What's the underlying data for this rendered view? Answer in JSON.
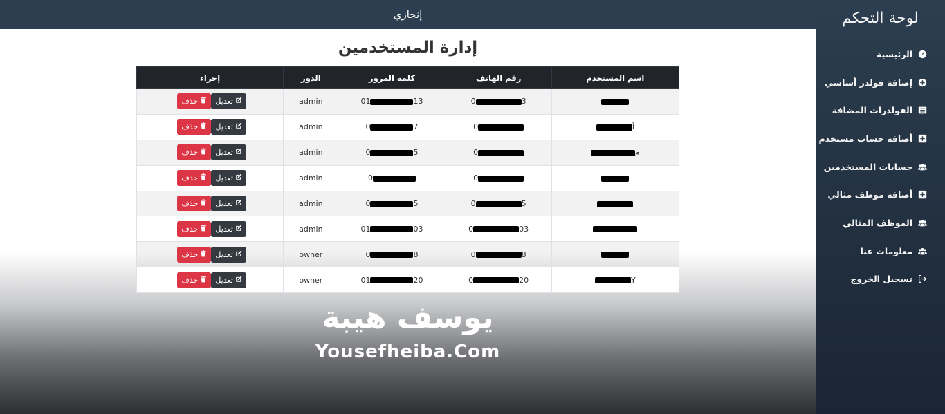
{
  "topbar": {
    "title": "إنجازي"
  },
  "sidebar": {
    "title": "لوحة التحكم",
    "items": [
      {
        "label": "الرئيسية",
        "icon": "dashboard-icon"
      },
      {
        "label": "إضافة فولدر أساسي",
        "icon": "plus-circle-icon"
      },
      {
        "label": "الفولدرات المضافة",
        "icon": "list-icon"
      },
      {
        "label": "أضافه حساب مستخدم",
        "icon": "plus-square-icon"
      },
      {
        "label": "حسابات المستخدمين",
        "icon": "users-icon"
      },
      {
        "label": "أضافه موظف مثالي",
        "icon": "plus-square-icon"
      },
      {
        "label": "الموظف المثالي",
        "icon": "users-icon"
      },
      {
        "label": "معلومات عنا",
        "icon": "users-icon"
      },
      {
        "label": "تسجيل الخروج",
        "icon": "sign-out-icon"
      }
    ]
  },
  "main": {
    "title": "إدارة المستخدمين",
    "table": {
      "headers": [
        "اسم المستخدم",
        "رقم الهاتف",
        "كلمة المرور",
        "الدور",
        "إجراء"
      ],
      "edit_label": "تعديل",
      "delete_label": "حذف",
      "rows": [
        {
          "name": "",
          "phone_prefix": "0",
          "phone_suffix": "3",
          "pass_prefix": "01",
          "pass_suffix": "13",
          "role": "admin"
        },
        {
          "name": "أ",
          "phone_prefix": "0",
          "phone_suffix": "",
          "pass_prefix": "0",
          "pass_suffix": "7",
          "role": "admin"
        },
        {
          "name": "م",
          "phone_prefix": "0",
          "phone_suffix": "",
          "pass_prefix": "0",
          "pass_suffix": "5",
          "role": "admin"
        },
        {
          "name": "",
          "phone_prefix": "0",
          "phone_suffix": "",
          "pass_prefix": "0",
          "pass_suffix": "",
          "role": "admin"
        },
        {
          "name": "",
          "phone_prefix": "0",
          "phone_suffix": "5",
          "pass_prefix": "0",
          "pass_suffix": "5",
          "role": "admin"
        },
        {
          "name": "",
          "phone_prefix": "0",
          "phone_suffix": "03",
          "pass_prefix": "01",
          "pass_suffix": "03",
          "role": "admin"
        },
        {
          "name": "",
          "phone_prefix": "0",
          "phone_suffix": "8",
          "pass_prefix": "0",
          "pass_suffix": "8",
          "role": "owner"
        },
        {
          "name": "Y",
          "phone_prefix": "0",
          "phone_suffix": "20",
          "pass_prefix": "01",
          "pass_suffix": "20",
          "role": "owner"
        }
      ]
    }
  },
  "watermark": {
    "arabic": "يوسف هيبة",
    "english": "Yousefheiba.Com"
  },
  "colors": {
    "sidebar": "#2c3e50",
    "delete": "#dc3545",
    "edit": "#343a40",
    "table_head": "#212529"
  }
}
